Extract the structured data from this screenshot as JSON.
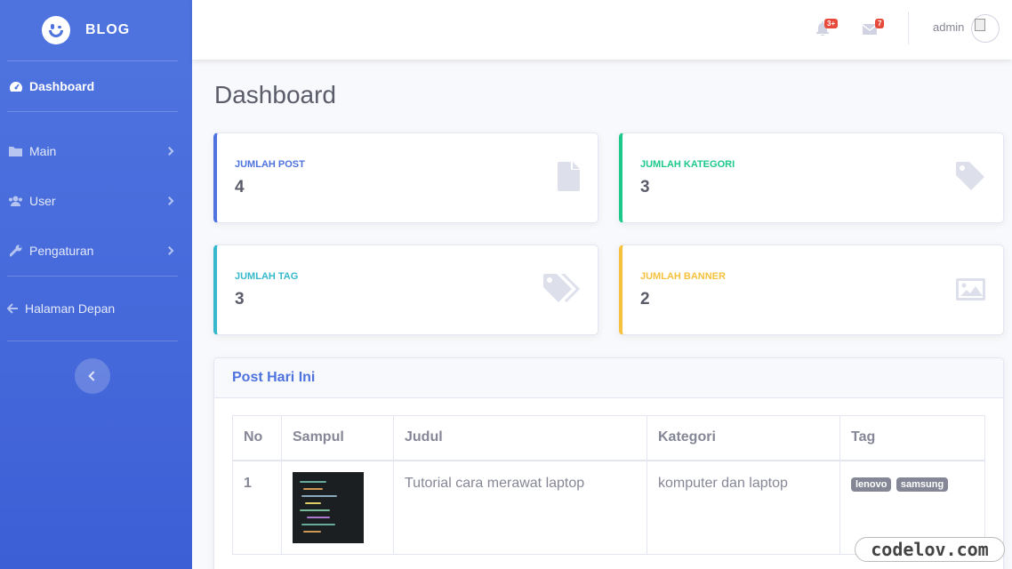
{
  "brand": {
    "name": "BLOG",
    "logo_icon": "winking-face-icon"
  },
  "sidebar": {
    "items": [
      {
        "label": "Dashboard",
        "icon": "tachometer-icon",
        "active": true
      },
      {
        "label": "Main",
        "icon": "folder-icon"
      },
      {
        "label": "User",
        "icon": "users-icon"
      },
      {
        "label": "Pengaturan",
        "icon": "wrench-icon"
      },
      {
        "label": "Halaman Depan",
        "icon": "arrow-left-icon"
      }
    ]
  },
  "topbar": {
    "alerts_badge": "3+",
    "messages_badge": "7",
    "username": "admin"
  },
  "page": {
    "title": "Dashboard"
  },
  "stats": [
    {
      "label": "JUMLAH POST",
      "value": "4",
      "color": "#4e73df",
      "icon": "file-icon"
    },
    {
      "label": "JUMLAH KATEGORI",
      "value": "3",
      "color": "#1cc88a",
      "icon": "tag-icon"
    },
    {
      "label": "JUMLAH TAG",
      "value": "3",
      "color": "#36b9cc",
      "icon": "tags-icon"
    },
    {
      "label": "JUMLAH BANNER",
      "value": "2",
      "color": "#f6c23e",
      "icon": "image-icon"
    }
  ],
  "posts": {
    "title": "Post Hari Ini",
    "columns": [
      "No",
      "Sampul",
      "Judul",
      "Kategori",
      "Tag"
    ],
    "rows": [
      {
        "no": "1",
        "judul": "Tutorial cara merawat laptop",
        "kategori": "komputer dan laptop",
        "tags": [
          "lenovo",
          "samsung"
        ]
      }
    ]
  },
  "watermark": "codelov.com"
}
